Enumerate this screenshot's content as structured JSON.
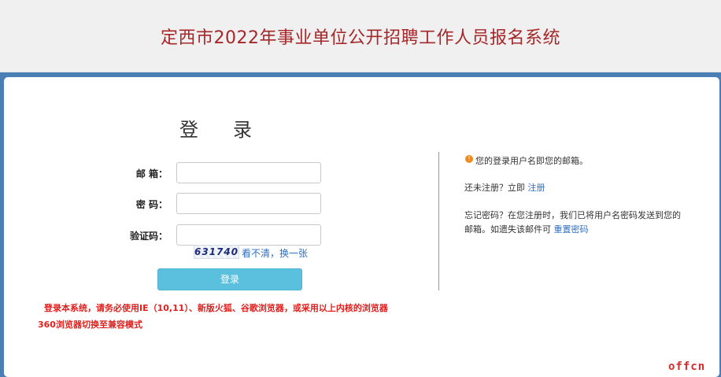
{
  "header": {
    "title": "定西市2022年事业单位公开招聘工作人员报名系统"
  },
  "login": {
    "heading": "登录",
    "email_label": "邮 箱：",
    "password_label": "密 码：",
    "captcha_label": "验证码：",
    "email_value": "",
    "password_value": "",
    "captcha_value": "",
    "captcha_image_text": "631740",
    "captcha_refresh_link": "看不清，换一张",
    "button_label": "登录"
  },
  "notices": {
    "line1": "登录本系统，请务必使用IE（10,11）、新版火狐、谷歌浏览器，或采用以上内核的浏览器",
    "line2": "360浏览器切换至兼容模式"
  },
  "info": {
    "icon": "info-icon",
    "tip": "您的登录用户名即您的邮箱。",
    "register_prompt": "还未注册？立即",
    "register_link": "注册",
    "forgot_line1": "忘记密码？在您注册时，我们已将用户名密码发送到您的",
    "forgot_line2": "邮箱。如遗失该邮件可",
    "reset_link": "重置密码"
  },
  "watermark": "offcn",
  "colors": {
    "title": "#a6272a",
    "blue_bar": "#4a7fb5",
    "button": "#5bc0de",
    "notice": "#e0201c",
    "link": "#2f6fc0"
  }
}
